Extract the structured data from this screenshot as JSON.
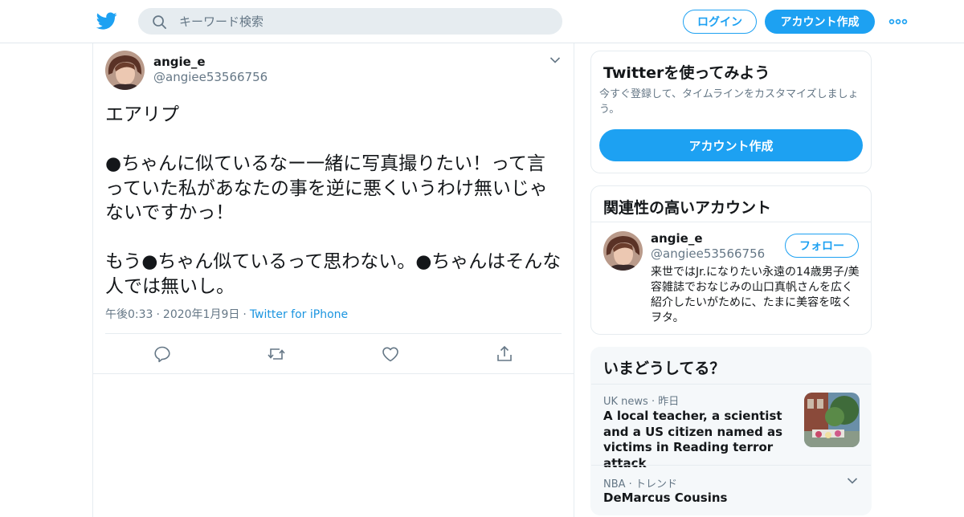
{
  "header": {
    "search_placeholder": "キーワード検索",
    "login_label": "ログイン",
    "signup_label": "アカウント作成"
  },
  "tweet": {
    "display_name": "angie_e",
    "handle": "@angiee53566756",
    "text": "エアリプ\n\n●ちゃんに似ているなー一緒に写真撮りたい！って言っていた私があなたの事を逆に悪くいうわけ無いじゃないですかっ！\n\nもう●ちゃん似ているって思わない。●ちゃんはそんな人では無いし。",
    "time": "午後0:33",
    "date": "2020年1月9日",
    "source": "Twitter for iPhone"
  },
  "signup_card": {
    "title": "Twitterを使ってみよう",
    "subtitle": "今すぐ登録して、タイムラインをカスタマイズしましょう。",
    "button_label": "アカウント作成"
  },
  "related": {
    "title": "関連性の高いアカウント",
    "name": "angie_e",
    "handle": "@angiee53566756",
    "follow_label": "フォロー",
    "bio": "来世ではJr.になりたい永遠の14歳男子/美容雑誌でおなじみの山口真帆さんを広く紹介したいがために、たまに美容を呟くヲタ。"
  },
  "trends": {
    "title": "いまどうしてる？",
    "items": [
      {
        "category": "UK news",
        "time": "昨日",
        "title": "A local teacher, a scientist and a US citizen named as victims in Reading terror attack"
      },
      {
        "category": "NBA",
        "time": "トレンド",
        "title": "DeMarcus Cousins"
      }
    ]
  },
  "colors": {
    "accent": "#1da1f2",
    "secondary_text": "#657786",
    "border": "#e6ecf0"
  }
}
